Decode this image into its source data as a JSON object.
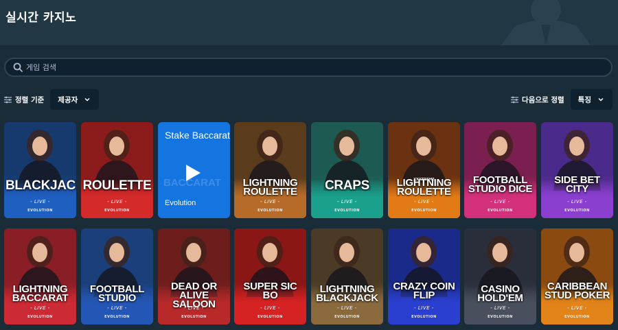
{
  "header": {
    "title": "실시간 카지노"
  },
  "search": {
    "placeholder": "게임 검색",
    "value": ""
  },
  "filters": {
    "sort_label": "정렬 기준",
    "provider_value": "제공자",
    "order_label": "다음으로 정렬",
    "order_value": "특징"
  },
  "accent": "#1475e1",
  "games": [
    {
      "title": "BLACKJACK",
      "sub": "- LIVE -",
      "brand": "EVOLUTION",
      "bg": "#163a6e",
      "band": "#1f5fc0"
    },
    {
      "title": "ROULETTE",
      "sub": "- LIVE -",
      "brand": "EVOLUTION",
      "bg": "#8c1b1b",
      "band": "#d42a2a"
    },
    {
      "title": "Stake Baccarat",
      "watermark": "BACCARAT",
      "provider": "Evolution"
    },
    {
      "title": "LIGHTNING ROULETTE",
      "sub": "- LIVE -",
      "brand": "EVOLUTION",
      "bg": "#5a3b1c",
      "band": "#b76b28"
    },
    {
      "title": "CRAPS",
      "sub": "- LIVE -",
      "brand": "EVOLUTION",
      "bg": "#1c5a52",
      "band": "#1aa08c"
    },
    {
      "title": "LIGHTNING ROULETTE",
      "supra": "XXXTREME",
      "sub": "- LIVE -",
      "brand": "EVOLUTION",
      "bg": "#6a3210",
      "band": "#e27a16"
    },
    {
      "title": "FOOTBALL STUDIO DICE",
      "sub": "- LIVE -",
      "brand": "EVOLUTION",
      "bg": "#7a1f4f",
      "band": "#d2307a"
    },
    {
      "title": "SIDE BET CITY",
      "sub": "- LIVE -",
      "brand": "EVOLUTION",
      "bg": "#4a2a8a",
      "band": "#8a3fcf"
    },
    {
      "title": "LIGHTNING BACCARAT",
      "sub": "- LIVE -",
      "brand": "EVOLUTION",
      "bg": "#8a1e26",
      "band": "#cc2a35"
    },
    {
      "title": "FOOTBALL STUDIO",
      "sub": "- LIVE -",
      "brand": "EVOLUTION",
      "bg": "#1a3f7a",
      "band": "#2456b5"
    },
    {
      "title": "DEAD OR ALIVE SALOON",
      "sub": "- LIVE -",
      "brand": "EVOLUTION",
      "bg": "#6e1d1d",
      "band": "#b82a2a"
    },
    {
      "title": "SUPER SIC BO",
      "sub": "- LIVE -",
      "brand": "EVOLUTION",
      "bg": "#8a1616",
      "band": "#d62222"
    },
    {
      "title": "LIGHTNING BLACKJACK",
      "sub": "- LIVE -",
      "brand": "EVOLUTION",
      "bg": "#4a3a26",
      "band": "#8a6a3c"
    },
    {
      "title": "CRAZY COIN FLIP",
      "sub": "- LIVE -",
      "brand": "EVOLUTION",
      "bg": "#1a2a8a",
      "band": "#2a3fcf"
    },
    {
      "title": "CASINO HOLD'EM",
      "sub": "- LIVE -",
      "brand": "EVOLUTION",
      "bg": "#2a2e3a",
      "band": "#4a4f5e"
    },
    {
      "title": "CARIBBEAN STUD POKER",
      "sub": "- LIVE -",
      "brand": "EVOLUTION",
      "bg": "#8a4a10",
      "band": "#e2841a"
    }
  ]
}
